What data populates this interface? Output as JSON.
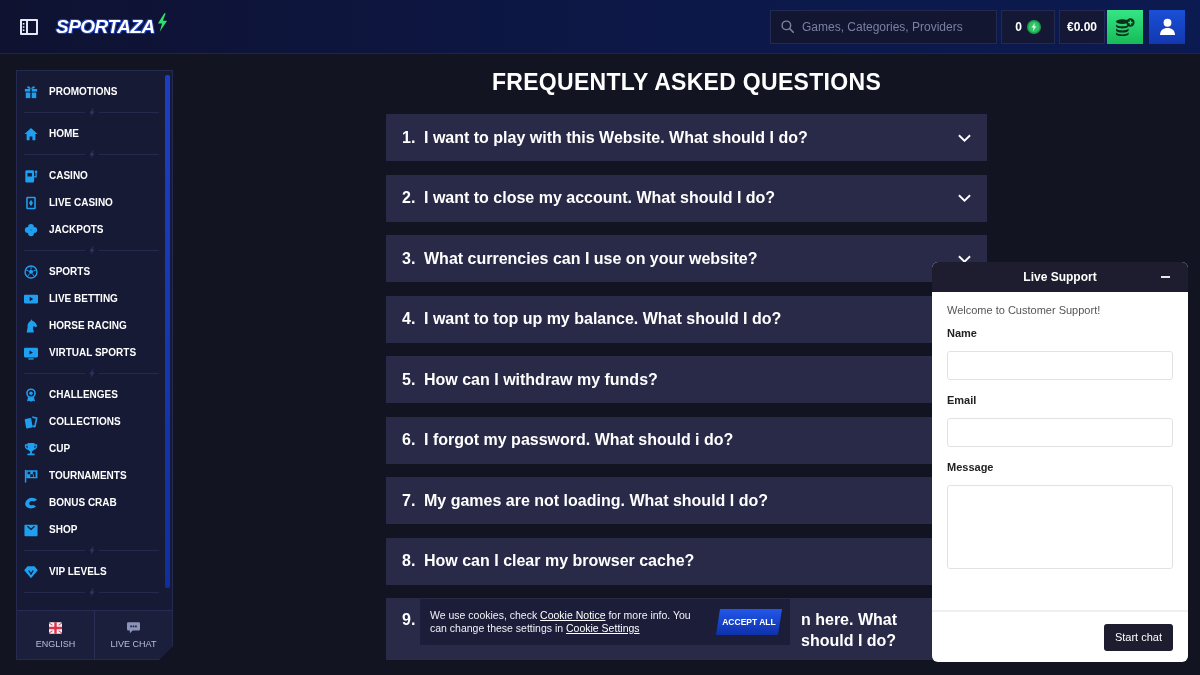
{
  "header": {
    "logo": "SPORTAZA",
    "search": {
      "placeholder": "Games, Categories, Providers"
    },
    "coins": "0",
    "balance": "€0.00"
  },
  "sidebar": {
    "groups": [
      {
        "items": [
          {
            "label": "PROMOTIONS",
            "selected": false
          }
        ]
      },
      {
        "items": [
          {
            "label": "HOME",
            "selected": false
          }
        ]
      },
      {
        "items": [
          {
            "label": "CASINO",
            "selected": false
          },
          {
            "label": "LIVE CASINO",
            "selected": false
          },
          {
            "label": "JACKPOTS",
            "selected": false
          }
        ]
      },
      {
        "items": [
          {
            "label": "SPORTS",
            "selected": false
          },
          {
            "label": "LIVE BETTING",
            "selected": false
          },
          {
            "label": "HORSE RACING",
            "selected": false
          },
          {
            "label": "VIRTUAL SPORTS",
            "selected": false
          }
        ]
      },
      {
        "items": [
          {
            "label": "CHALLENGES",
            "selected": false
          },
          {
            "label": "COLLECTIONS",
            "selected": false
          },
          {
            "label": "CUP",
            "selected": false
          },
          {
            "label": "TOURNAMENTS",
            "selected": false
          },
          {
            "label": "BONUS CRAB",
            "selected": false
          },
          {
            "label": "SHOP",
            "selected": false
          }
        ]
      },
      {
        "items": [
          {
            "label": "VIP LEVELS",
            "selected": false
          }
        ]
      }
    ],
    "footer": [
      {
        "label": "ENGLISH"
      },
      {
        "label": "LIVE CHAT"
      }
    ]
  },
  "faq": {
    "title": "FREQUENTLY ASKED QUESTIONS",
    "items": [
      {
        "kind": "full",
        "number": "1.",
        "question": "I want to play with this Website. What should I do?",
        "expanded": false
      },
      {
        "kind": "full",
        "number": "2.",
        "question": "I want to close my account. What should I do?",
        "expanded": false
      },
      {
        "kind": "full",
        "number": "3.",
        "question": "What currencies can I use on your website?",
        "expanded": false
      },
      {
        "kind": "full",
        "number": "4.",
        "question": "I want to top up my balance. What should I do?"
      },
      {
        "kind": "full",
        "number": "5.",
        "question": "How can I withdraw my funds?"
      },
      {
        "kind": "full",
        "number": "6.",
        "question": "I forgot my password. What should i do?"
      },
      {
        "kind": "full",
        "number": "7.",
        "question": "My games are not loading. What should I do?"
      },
      {
        "kind": "full",
        "number": "8.",
        "question": "How can I clear my browser cache?"
      },
      {
        "kind": "covered",
        "number": "9.",
        "question": "n here. What should I do?"
      }
    ]
  },
  "cookie_banner": {
    "segments": [
      {
        "kind": "text",
        "text": "We use cookies, check "
      },
      {
        "kind": "link",
        "text": "Cookie Notice"
      },
      {
        "kind": "text",
        "text": " for more info. You can change these settings in "
      },
      {
        "kind": "link",
        "text": "Cookie Settings"
      }
    ],
    "button": "ACCEPT ALL"
  },
  "live_support": {
    "title": "Live Support",
    "welcome": "Welcome to Customer Support!",
    "fields": [
      {
        "kind": "input",
        "label": "Name"
      },
      {
        "kind": "input",
        "label": "Email"
      },
      {
        "kind": "textarea",
        "label": "Message"
      }
    ],
    "button": "Start chat"
  }
}
